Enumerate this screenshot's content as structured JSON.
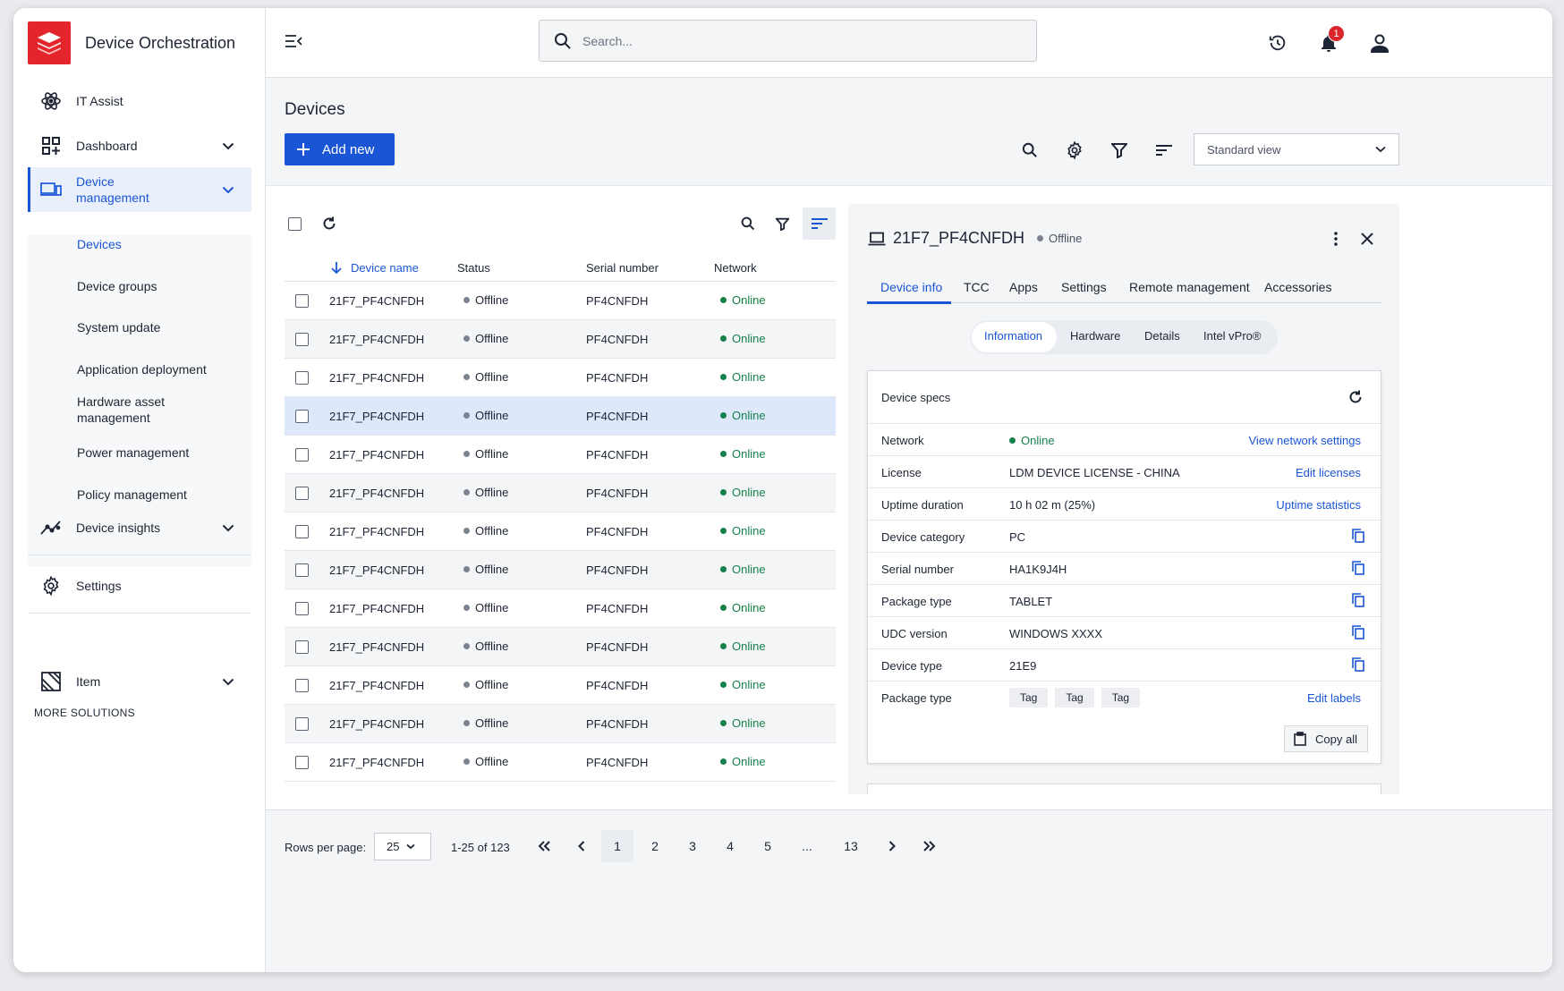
{
  "app": {
    "title": "Device Orchestration"
  },
  "sidebar": {
    "items": [
      {
        "label": "IT Assist",
        "icon": "atom-icon"
      },
      {
        "label": "Dashboard",
        "icon": "dashboard-icon"
      },
      {
        "label": "Device management",
        "icon": "devices-icon"
      },
      {
        "label": "Device insights",
        "icon": "insights-icon"
      },
      {
        "label": "Settings",
        "icon": "gear-icon"
      }
    ],
    "device_management_sub": [
      "Devices",
      "Device groups",
      "System update",
      "Application deployment",
      "Hardware asset management",
      "Power management",
      "Policy management"
    ],
    "more_solutions_label": "MORE SOLUTIONS",
    "more_item": {
      "label": "Item",
      "icon": "item-icon"
    }
  },
  "topbar": {
    "search_placeholder": "Search...",
    "notification_count": "1"
  },
  "page": {
    "title": "Devices",
    "add_new_label": "Add new",
    "view_select": "Standard view"
  },
  "table": {
    "columns": [
      "Device name",
      "Status",
      "Serial number",
      "Network"
    ],
    "rows": [
      {
        "name": "21F7_PF4CNFDH",
        "status": "Offline",
        "serial": "PF4CNFDH",
        "network": "Online"
      },
      {
        "name": "21F7_PF4CNFDH",
        "status": "Offline",
        "serial": "PF4CNFDH",
        "network": "Online"
      },
      {
        "name": "21F7_PF4CNFDH",
        "status": "Offline",
        "serial": "PF4CNFDH",
        "network": "Online"
      },
      {
        "name": "21F7_PF4CNFDH",
        "status": "Offline",
        "serial": "PF4CNFDH",
        "network": "Online"
      },
      {
        "name": "21F7_PF4CNFDH",
        "status": "Offline",
        "serial": "PF4CNFDH",
        "network": "Online"
      },
      {
        "name": "21F7_PF4CNFDH",
        "status": "Offline",
        "serial": "PF4CNFDH",
        "network": "Online"
      },
      {
        "name": "21F7_PF4CNFDH",
        "status": "Offline",
        "serial": "PF4CNFDH",
        "network": "Online"
      },
      {
        "name": "21F7_PF4CNFDH",
        "status": "Offline",
        "serial": "PF4CNFDH",
        "network": "Online"
      },
      {
        "name": "21F7_PF4CNFDH",
        "status": "Offline",
        "serial": "PF4CNFDH",
        "network": "Online"
      },
      {
        "name": "21F7_PF4CNFDH",
        "status": "Offline",
        "serial": "PF4CNFDH",
        "network": "Online"
      },
      {
        "name": "21F7_PF4CNFDH",
        "status": "Offline",
        "serial": "PF4CNFDH",
        "network": "Online"
      },
      {
        "name": "21F7_PF4CNFDH",
        "status": "Offline",
        "serial": "PF4CNFDH",
        "network": "Online"
      },
      {
        "name": "21F7_PF4CNFDH",
        "status": "Offline",
        "serial": "PF4CNFDH",
        "network": "Online"
      }
    ]
  },
  "detail": {
    "name": "21F7_PF4CNFDH",
    "status": "Offline",
    "tabs": [
      "Device info",
      "TCC",
      "Apps",
      "Settings",
      "Remote management",
      "Accessories"
    ],
    "subtabs": [
      "Information",
      "Hardware",
      "Details",
      "Intel vPro®"
    ],
    "card_title": "Device specs",
    "specs": [
      {
        "key": "Network",
        "value": "Online",
        "action": "View network settings"
      },
      {
        "key": "License",
        "value": "LDM DEVICE LICENSE - CHINA",
        "action": "Edit licenses"
      },
      {
        "key": "Uptime duration",
        "value": "10 h 02 m (25%)",
        "action": "Uptime statistics"
      },
      {
        "key": "Device category",
        "value": "PC"
      },
      {
        "key": "Serial number",
        "value": "HA1K9J4H"
      },
      {
        "key": "Package type",
        "value": "TABLET"
      },
      {
        "key": "UDC version",
        "value": "WINDOWS XXXX"
      },
      {
        "key": "Device type",
        "value": "21E9"
      },
      {
        "key": "Package type",
        "tags": [
          "Tag",
          "Tag",
          "Tag"
        ],
        "action": "Edit labels"
      }
    ],
    "copy_all_label": "Copy all"
  },
  "pagination": {
    "rows_per_page_label": "Rows per page:",
    "rows_per_page": "25",
    "range": "1-25 of 123",
    "pages": [
      "1",
      "2",
      "3",
      "4",
      "5",
      "...",
      "13"
    ],
    "current_page": "1"
  },
  "colors": {
    "accent": "#1a55d6",
    "brand": "#e4252b",
    "online": "#14804a",
    "badge": "#d9262c"
  }
}
